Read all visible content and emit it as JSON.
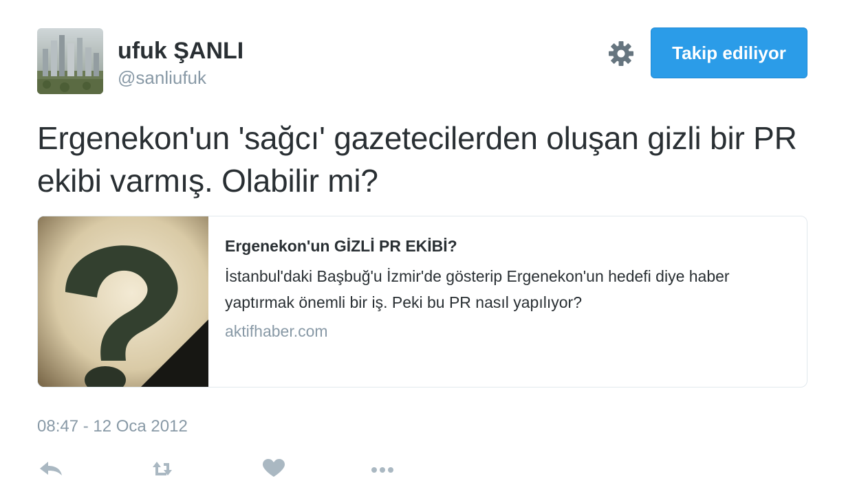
{
  "user": {
    "display_name": "ufuk ŞANLI",
    "handle": "@sanliufuk"
  },
  "header": {
    "settings_icon": "gear-icon",
    "follow_label": "Takip ediliyor",
    "accent_color": "#2b9ce8"
  },
  "tweet": {
    "text": "Ergenekon'un 'sağcı' gazetecilerden oluşan gizli bir PR ekibi varmış. Olabilir mi?",
    "timestamp": "08:47 - 12 Oca 2012"
  },
  "card": {
    "image_icon": "question-mark-image",
    "title": "Ergenekon'un GİZLİ PR EKİBİ?",
    "description": "İstanbul'daki Başbuğ'u İzmir'de gösterip Ergenekon'un hedefi diye haber yaptırmak önemli bir iş. Peki bu PR nasıl yapılıyor?",
    "domain": "aktifhaber.com"
  },
  "actions": {
    "icons": [
      "reply-icon",
      "retweet-icon",
      "like-icon",
      "more-icon"
    ],
    "icon_color": "#aab8c2"
  }
}
